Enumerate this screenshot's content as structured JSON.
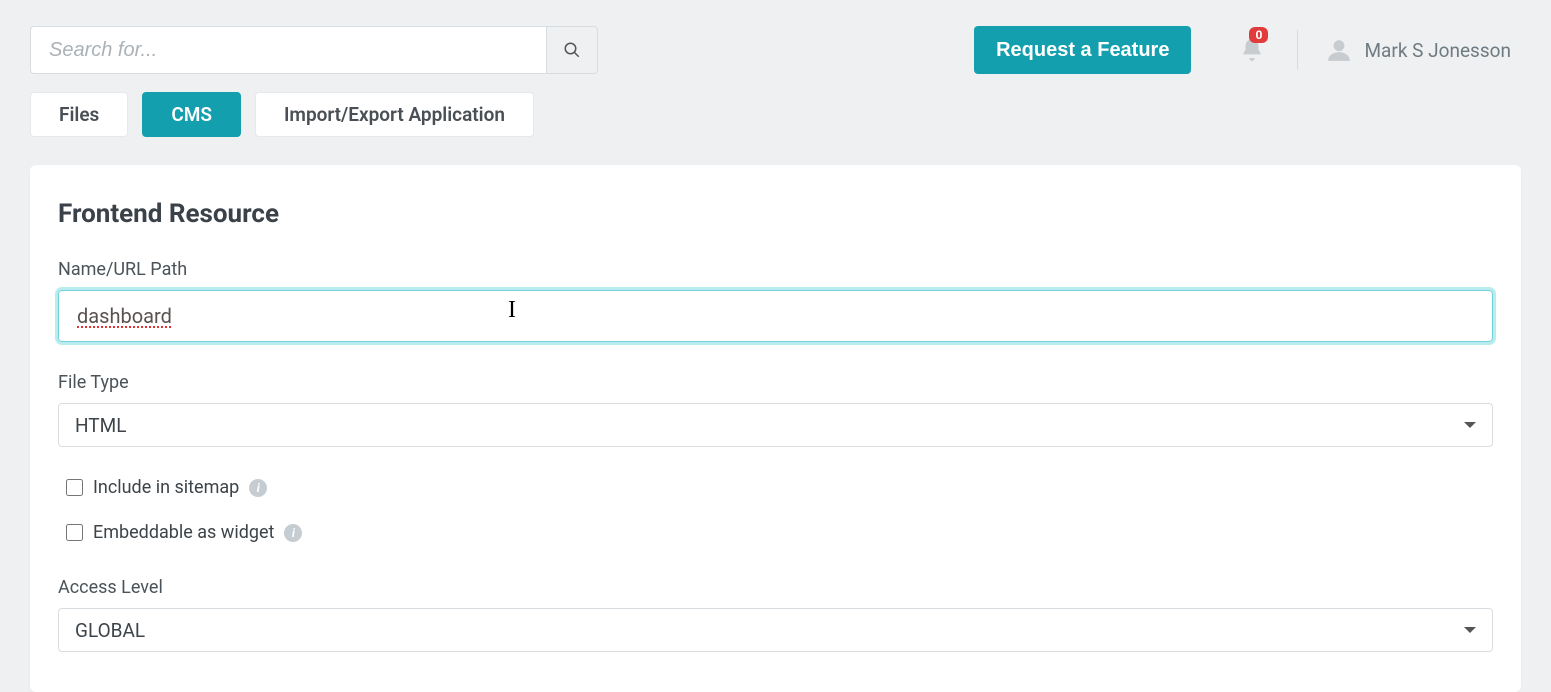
{
  "header": {
    "search_placeholder": "Search for...",
    "feature_button": "Request a Feature",
    "notification_count": "0",
    "user_name": "Mark S Jonesson"
  },
  "tabs": {
    "files": "Files",
    "cms": "CMS",
    "import_export": "Import/Export Application"
  },
  "panel": {
    "title": "Frontend Resource",
    "name_label": "Name/URL Path",
    "name_value": "dashboard",
    "file_type_label": "File Type",
    "file_type_value": "HTML",
    "include_sitemap_label": "Include in sitemap",
    "embeddable_label": "Embeddable as widget",
    "access_level_label": "Access Level",
    "access_level_value": "GLOBAL"
  },
  "icons": {
    "info": "i"
  }
}
